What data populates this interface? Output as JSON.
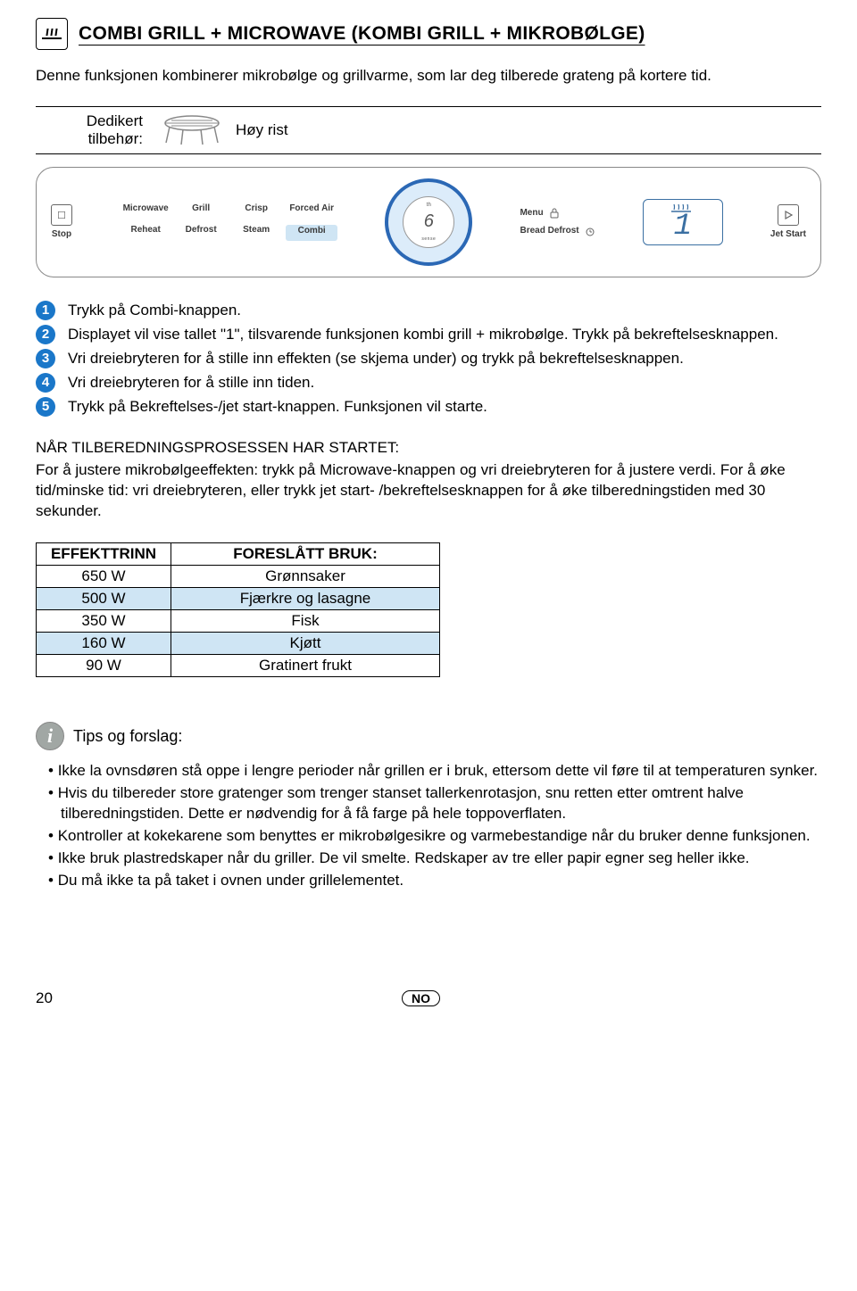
{
  "title": "COMBI GRILL + MICROWAVE (KOMBI GRILL + MIKROBØLGE)",
  "intro": "Denne funksjonen kombinerer mikrobølge og grillvarme, som lar deg tilberede grateng på kortere tid.",
  "accessory": {
    "label": "Dedikert tilbehør:",
    "name": "Høy rist"
  },
  "panel": {
    "stop": "Stop",
    "jet": "Jet Start",
    "row1": [
      "Microwave",
      "Grill",
      "Crisp",
      "Forced Air"
    ],
    "row2": [
      "Reheat",
      "Defrost",
      "Steam",
      "Combi"
    ],
    "menu": "Menu",
    "bread": "Bread Defrost",
    "dial_digit": "6",
    "dial_th": "th",
    "dial_sense": "sense",
    "display_digit": "1"
  },
  "steps": [
    "Trykk på Combi-knappen.",
    "Displayet vil vise tallet \"1\", tilsvarende funksjonen kombi grill + mikrobølge. Trykk på bekreftelsesknappen.",
    "Vri dreiebryteren for å stille inn effekten (se skjema under) og trykk på bekreftelsesknappen.",
    "Vri dreiebryteren for å stille inn tiden.",
    "Trykk på Bekreftelses-/jet start-knappen. Funksjonen vil starte."
  ],
  "after_start": {
    "heading": "NÅR TILBEREDNINGSPROSESSEN HAR STARTET:",
    "body": "For å justere mikrobølgeeffekten: trykk på Microwave-knappen og vri dreiebryteren for å justere verdi. For å øke tid/minske tid: vri dreiebryteren, eller trykk jet start- /bekreftelsesknappen for å øke tilberedningstiden med 30 sekunder."
  },
  "table": {
    "headers": [
      "EFFEKTTRINN",
      "FORESLÅTT BRUK:"
    ],
    "rows": [
      {
        "power": "650 W",
        "use": "Grønnsaker",
        "blue": false
      },
      {
        "power": "500 W",
        "use": "Fjærkre og lasagne",
        "blue": true
      },
      {
        "power": "350 W",
        "use": "Fisk",
        "blue": false
      },
      {
        "power": "160 W",
        "use": "Kjøtt",
        "blue": true
      },
      {
        "power": "90 W",
        "use": "Gratinert frukt",
        "blue": false
      }
    ]
  },
  "tips": {
    "title": "Tips og forslag:",
    "items": [
      "Ikke la ovnsdøren stå oppe i lengre perioder når grillen er i bruk, ettersom dette vil føre til at temperaturen synker.",
      "Hvis du tilbereder store gratenger som trenger stanset tallerkenrotasjon, snu retten etter omtrent halve tilberedningstiden. Dette er nødvendig for å få farge på hele toppoverflaten.",
      "Kontroller at kokekarene som benyttes er mikrobølgesikre og varmebestandige når du bruker denne funksjonen.",
      "Ikke bruk plastredskaper når du griller. De vil smelte. Redskaper av tre eller papir egner seg heller ikke.",
      "Du må ikke ta på taket i ovnen under grillelementet."
    ]
  },
  "footer": {
    "page": "20",
    "lang": "NO"
  },
  "chart_data": {
    "type": "table",
    "title": "Effekttrinn vs foreslått bruk",
    "columns": [
      "EFFEKTTRINN",
      "FORESLÅTT BRUK:"
    ],
    "rows": [
      [
        "650 W",
        "Grønnsaker"
      ],
      [
        "500 W",
        "Fjærkre og lasagne"
      ],
      [
        "350 W",
        "Fisk"
      ],
      [
        "160 W",
        "Kjøtt"
      ],
      [
        "90 W",
        "Gratinert frukt"
      ]
    ]
  }
}
